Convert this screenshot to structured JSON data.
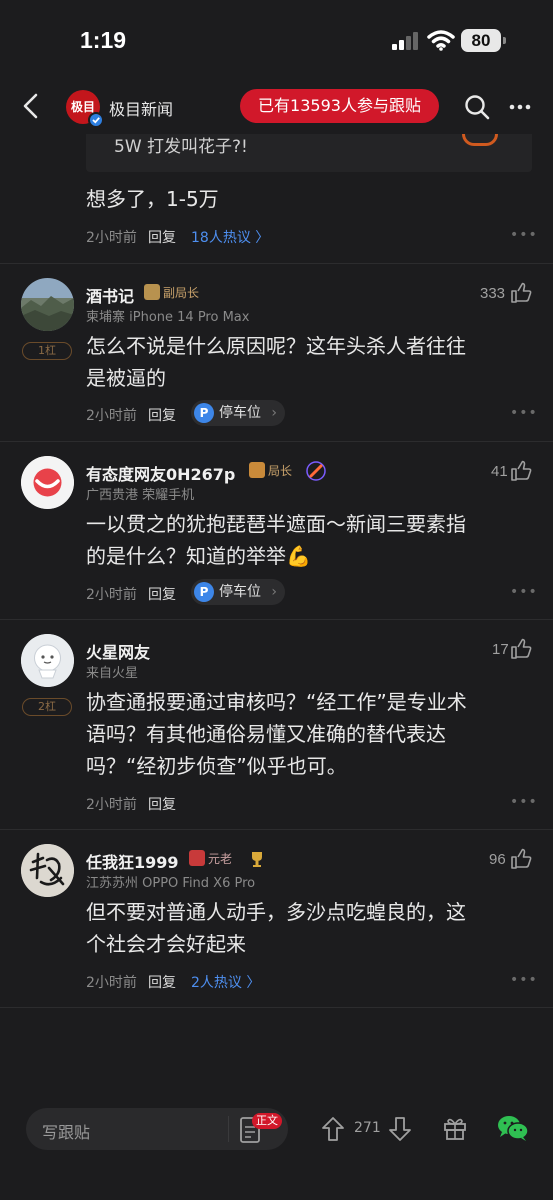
{
  "status_bar": {
    "time": "1:19",
    "battery": "80"
  },
  "nav": {
    "logo_text": "极目",
    "title": "极目新闻",
    "pill": "已有13593人参与跟贴"
  },
  "top_thread": {
    "quote": "5W  打发叫花子?!",
    "reply": "想多了，1-5万",
    "time": "2小时前",
    "reply_label": "回复",
    "hot": "18人热议 〉"
  },
  "comments": [
    {
      "name": "酒书记",
      "badge": "副局长",
      "sub": "柬埔寨  iPhone 14 Pro Max",
      "floor": "1杠",
      "likes": "333",
      "lines": [
        "怎么不说是什么原因呢？这年头杀人者往往",
        "是被逼的"
      ],
      "time": "2小时前",
      "reply_label": "回复",
      "tag": "停车位"
    },
    {
      "name": "有态度网友0H267p",
      "badge": "局长",
      "sub": "广西贵港  荣耀手机",
      "likes": "41",
      "lines": [
        "一以贯之的犹抱琵琶半遮面～新闻三要素指",
        "的是什么？知道的举举💪"
      ],
      "time": "2小时前",
      "reply_label": "回复",
      "tag": "停车位"
    },
    {
      "name": "火星网友",
      "sub": "来自火星",
      "floor": "2杠",
      "likes": "17",
      "lines": [
        "协查通报要通过审核吗？“经工作”是专业术",
        "语吗？有其他通俗易懂又准确的替代表达",
        "吗？“经初步侦查”似乎也可。"
      ],
      "time": "2小时前",
      "reply_label": "回复"
    },
    {
      "name": "任我狂1999",
      "badge": "元老",
      "sub": "江苏苏州  OPPO Find X6 Pro",
      "likes": "96",
      "lines": [
        "但不要对普通人动手，多沙点吃蝗良的，这",
        "个社会才会好起来"
      ],
      "time": "2小时前",
      "reply_label": "回复",
      "hot": "2人热议 〉"
    }
  ],
  "more_dots": "•••",
  "bottom": {
    "placeholder": "写跟贴",
    "doc_badge": "正文",
    "count": "271"
  },
  "colors": {
    "accent_red": "#d1182a",
    "link_blue": "#4e8ff0",
    "bg": "#1c1c1e"
  }
}
